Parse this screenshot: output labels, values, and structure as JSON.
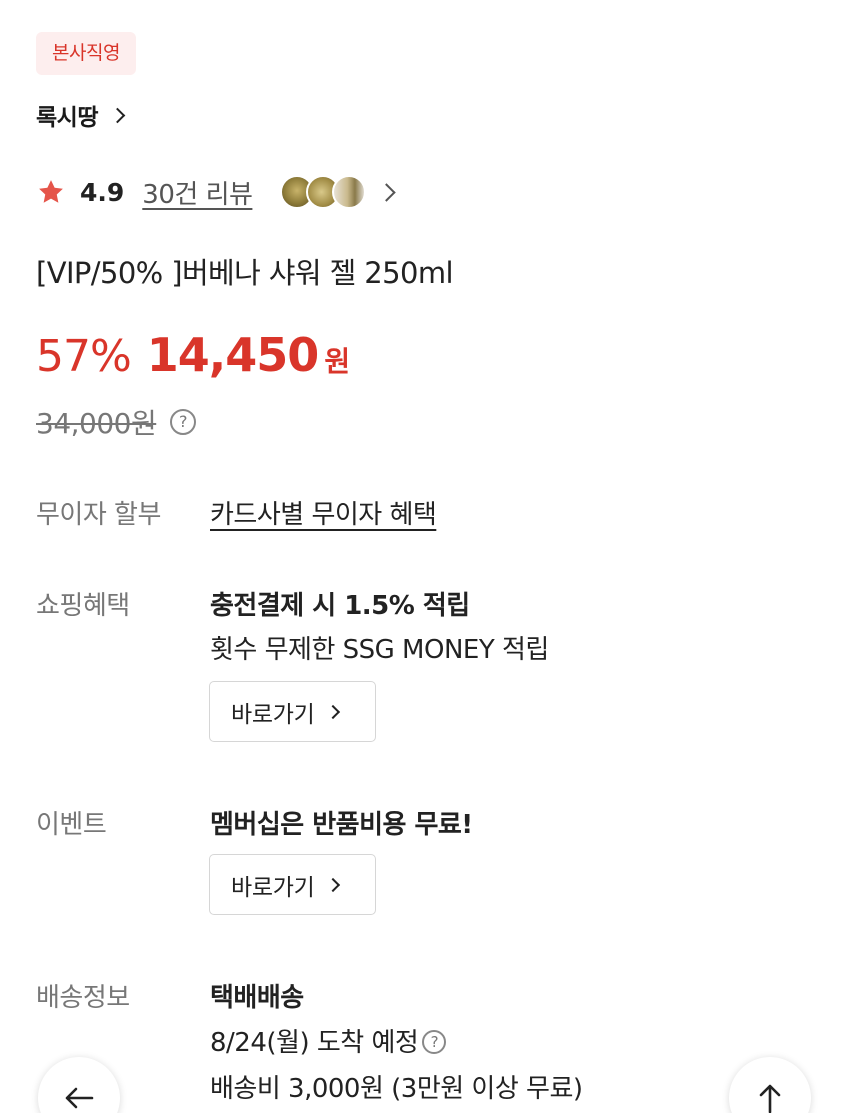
{
  "badge": "본사직영",
  "brand": {
    "name": "록시땅"
  },
  "rating": {
    "score": "4.9",
    "reviews": "30건 리뷰"
  },
  "product": {
    "title": "[VIP/50% ]버베나 샤워 젤 250ml"
  },
  "price": {
    "discount": "57%",
    "sale": "14,450",
    "currency": "원",
    "original": "34,000원",
    "help": "?"
  },
  "installment": {
    "label": "무이자 할부",
    "value": "카드사별 무이자 혜택"
  },
  "shopping": {
    "label": "쇼핑혜택",
    "title": "충전결제 시 1.5% 적립",
    "desc": "횟수 무제한 SSG MONEY 적립",
    "button": "바로가기"
  },
  "event": {
    "label": "이벤트",
    "title": "멤버십은 반품비용 무료!",
    "button": "바로가기"
  },
  "delivery": {
    "label": "배송정보",
    "title": "택배배송",
    "arrival": "8/24(월) 도착 예정",
    "fee": "배송비 3,000원 (3만원 이상 무료)",
    "help": "?"
  },
  "colors": {
    "accent": "#d9352a",
    "badge_bg": "#fdeeee"
  },
  "icons": {
    "star": "star-icon",
    "back": "arrow-left-icon",
    "top": "arrow-up-icon"
  }
}
